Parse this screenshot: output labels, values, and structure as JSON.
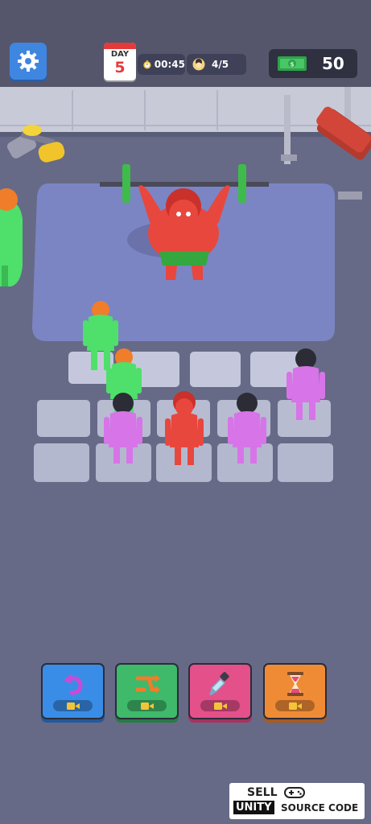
{
  "hud": {
    "day_label": "DAY",
    "day_number": "5",
    "timer": "00:45",
    "players": "4/5",
    "money": "50",
    "settings_icon": "gear-icon",
    "timer_icon": "stopwatch-icon",
    "players_icon": "player-face-icon",
    "money_icon": "cash-bill-icon"
  },
  "powerups": [
    {
      "name": "undo",
      "icon": "undo-arrow-icon",
      "badge_icon": "video-ad-icon",
      "color": "#3a8de6"
    },
    {
      "name": "shuffle",
      "icon": "swap-arrows-icon",
      "badge_icon": "video-ad-icon",
      "color": "#3fb96a"
    },
    {
      "name": "dropper",
      "icon": "eyedropper-icon",
      "badge_icon": "video-ad-icon",
      "color": "#e4508a"
    },
    {
      "name": "time",
      "icon": "hourglass-icon",
      "badge_icon": "video-ad-icon",
      "color": "#f08b35"
    }
  ],
  "watermark": {
    "line1": "SELL",
    "line2a": "UNITY",
    "line2b": "SOURCE CODE"
  },
  "colors": {
    "floor": "#666a87",
    "stage": "#7a86c4",
    "tile": "#cfd3e5",
    "red_character": "#e8473e",
    "green_character": "#4ee06a",
    "purple_character": "#d774e8"
  }
}
